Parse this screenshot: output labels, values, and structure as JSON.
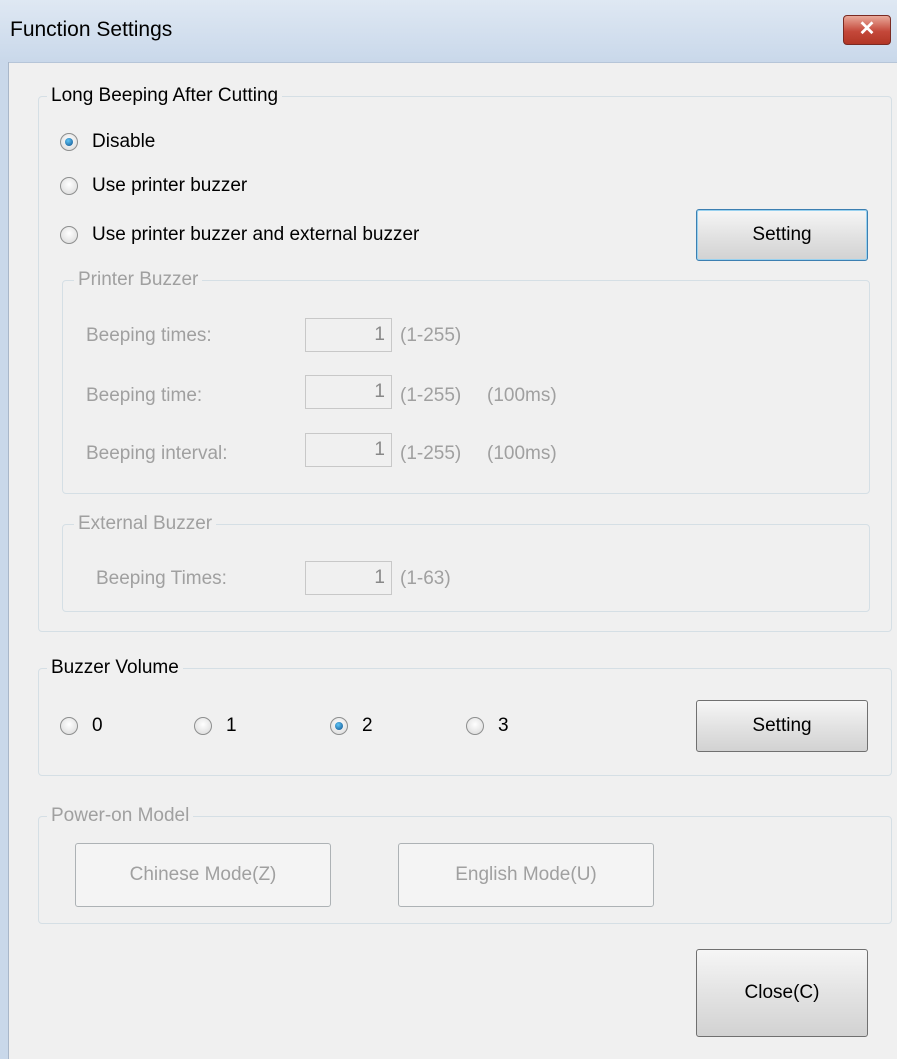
{
  "window": {
    "title": "Function Settings",
    "close_glyph": "✕"
  },
  "long_beeping": {
    "legend": "Long Beeping After Cutting",
    "options": [
      {
        "label": "Disable",
        "checked": true
      },
      {
        "label": "Use printer buzzer",
        "checked": false
      },
      {
        "label": "Use printer buzzer and external buzzer",
        "checked": false
      }
    ],
    "setting_button": "Setting",
    "printer_buzzer": {
      "legend": "Printer Buzzer",
      "rows": [
        {
          "label": "Beeping times:",
          "value": "1",
          "range": "(1-255)",
          "unit": ""
        },
        {
          "label": "Beeping time:",
          "value": "1",
          "range": "(1-255)",
          "unit": "(100ms)"
        },
        {
          "label": "Beeping interval:",
          "value": "1",
          "range": "(1-255)",
          "unit": "(100ms)"
        }
      ]
    },
    "external_buzzer": {
      "legend": "External Buzzer",
      "rows": [
        {
          "label": "Beeping Times:",
          "value": "1",
          "range": "(1-63)"
        }
      ]
    }
  },
  "buzzer_volume": {
    "legend": "Buzzer Volume",
    "options": [
      {
        "label": "0",
        "checked": false
      },
      {
        "label": "1",
        "checked": false
      },
      {
        "label": "2",
        "checked": true
      },
      {
        "label": "3",
        "checked": false
      }
    ],
    "setting_button": "Setting"
  },
  "power_on": {
    "legend": "Power-on Model",
    "chinese_button": "Chinese Mode(Z)",
    "english_button": "English Mode(U)"
  },
  "close_button": "Close(C)",
  "colors": {
    "titlebar": "#c9d8ea",
    "close_red": "#c4483a",
    "disabled_text": "#a0a0a0",
    "focus_border": "#3c7fb1"
  }
}
